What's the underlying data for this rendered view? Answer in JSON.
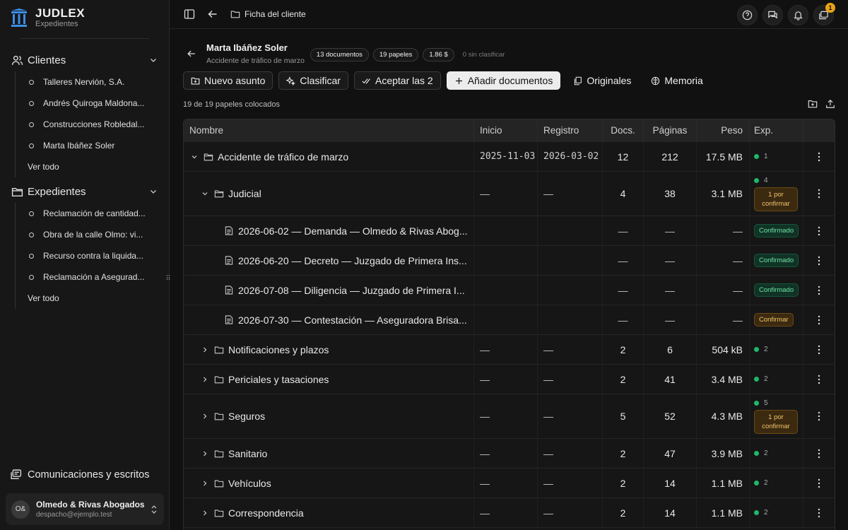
{
  "brand": {
    "name": "JUDLEX",
    "subtitle": "Expedientes"
  },
  "sidebar": {
    "clientes": {
      "label": "Clientes",
      "items": [
        "Talleres Nervión, S.A.",
        "Andrés Quiroga Maldona...",
        "Construcciones Robledal...",
        "Marta Ibáñez Soler"
      ],
      "see_all": "Ver todo"
    },
    "expedientes": {
      "label": "Expedientes",
      "items": [
        "Reclamación de cantidad...",
        "Obra de la calle Olmo: vi...",
        "Recurso contra la liquida...",
        "Reclamación a Asegurad..."
      ],
      "see_all": "Ver todo"
    },
    "communications": "Comunicaciones y escritos",
    "account": {
      "initials": "O&",
      "name": "Olmedo & Rivas Abogados",
      "email": "despacho@ejemplo.test"
    }
  },
  "topbar": {
    "breadcrumb": "Ficha del cliente",
    "notification_count": "1"
  },
  "header": {
    "title": "Marta Ibáñez Soler",
    "subtitle": "Accidente de tráfico de marzo",
    "pills": [
      "13 documentos",
      "19 papeles",
      "1.86 $"
    ],
    "unclassified": "0 sin clasificar"
  },
  "actions": {
    "new_matter": "Nuevo asunto",
    "classify": "Clasificar",
    "accept": "Aceptar las 2",
    "add_docs": "Añadir documentos",
    "originals": "Originales",
    "memory": "Memoria"
  },
  "count_text": "19 de 19 papeles colocados",
  "table": {
    "headers": {
      "name": "Nombre",
      "start": "Inicio",
      "registry": "Registro",
      "docs": "Docs.",
      "pages": "Páginas",
      "weight": "Peso",
      "exp": "Exp."
    },
    "rows": [
      {
        "name": "Accidente de tráfico de marzo",
        "start": "2025-11-03",
        "registry": "2026-03-02",
        "docs": "12",
        "pages": "212",
        "weight": "17.5 MB",
        "exp": "1",
        "pending": ""
      },
      {
        "name": "Judicial",
        "start": "—",
        "registry": "—",
        "docs": "4",
        "pages": "38",
        "weight": "3.1 MB",
        "exp": "4",
        "pending": "1 por confirmar"
      },
      {
        "name": "2026-06-02 — Demanda — Olmedo & Rivas Abog...",
        "dash": "—",
        "status": "Confirmado"
      },
      {
        "name": "2026-06-20 — Decreto — Juzgado de Primera Ins...",
        "dash": "—",
        "status": "Confirmado"
      },
      {
        "name": "2026-07-08 — Diligencia — Juzgado de Primera I...",
        "dash": "—",
        "status": "Confirmado"
      },
      {
        "name": "2026-07-30 — Contestación — Aseguradora Brisa...",
        "dash": "—",
        "status": "Confirmar"
      },
      {
        "name": "Notificaciones y plazos",
        "start": "—",
        "registry": "—",
        "docs": "2",
        "pages": "6",
        "weight": "504 kB",
        "exp": "2",
        "pending": ""
      },
      {
        "name": "Periciales y tasaciones",
        "start": "—",
        "registry": "—",
        "docs": "2",
        "pages": "41",
        "weight": "3.4 MB",
        "exp": "2",
        "pending": ""
      },
      {
        "name": "Seguros",
        "start": "—",
        "registry": "—",
        "docs": "5",
        "pages": "52",
        "weight": "4.3 MB",
        "exp": "5",
        "pending": "1 por confirmar"
      },
      {
        "name": "Sanitario",
        "start": "—",
        "registry": "—",
        "docs": "2",
        "pages": "47",
        "weight": "3.9 MB",
        "exp": "2",
        "pending": ""
      },
      {
        "name": "Vehículos",
        "start": "—",
        "registry": "—",
        "docs": "2",
        "pages": "14",
        "weight": "1.1 MB",
        "exp": "2",
        "pending": ""
      },
      {
        "name": "Correspondencia",
        "start": "—",
        "registry": "—",
        "docs": "2",
        "pages": "14",
        "weight": "1.1 MB",
        "exp": "2",
        "pending": ""
      }
    ]
  },
  "colors": {
    "accent_green": "#1fb86a",
    "pending_orange": "#f2c26a",
    "badge": "#e8a317"
  }
}
